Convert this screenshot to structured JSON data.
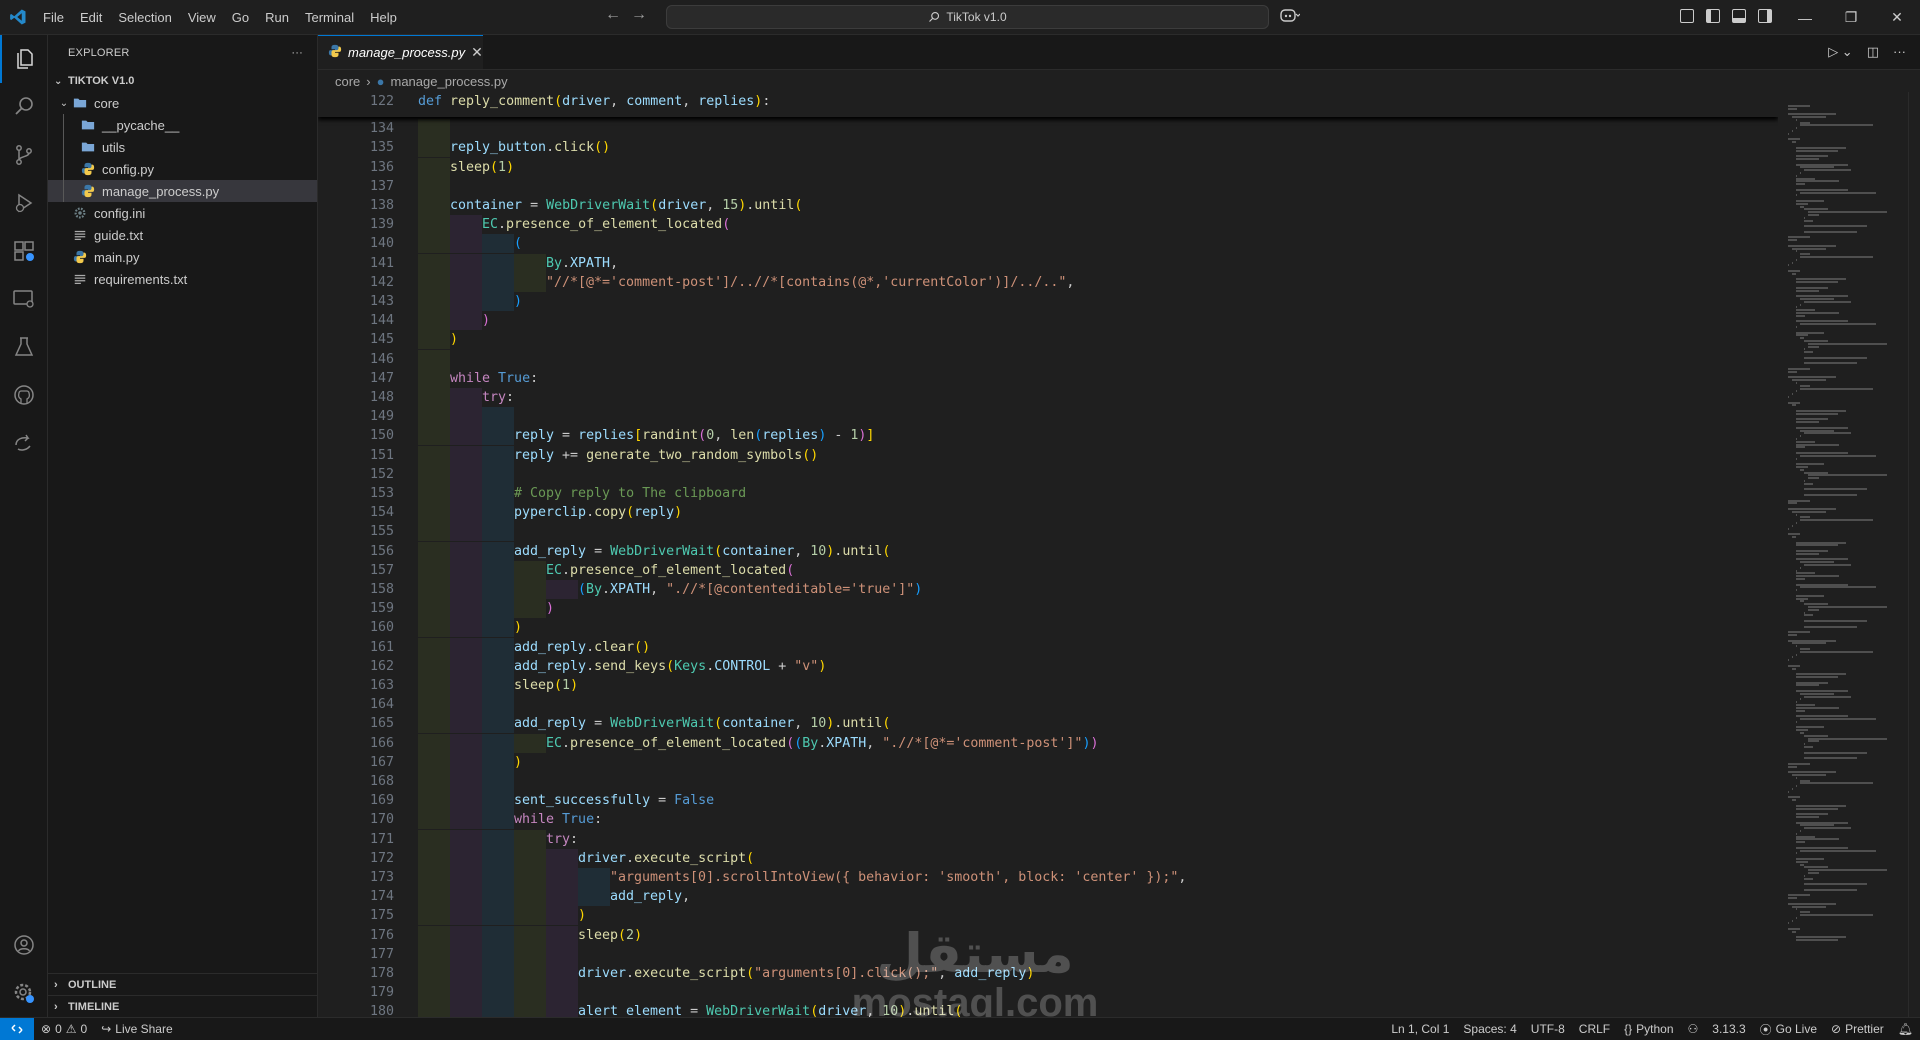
{
  "window": {
    "title": "TikTok v1.0"
  },
  "menu": [
    "File",
    "Edit",
    "Selection",
    "View",
    "Go",
    "Run",
    "Terminal",
    "Help"
  ],
  "activity_bar": [
    "explorer-icon",
    "search-icon",
    "source-control-icon",
    "run-debug-icon",
    "remote-explorer-icon",
    "remote-window-icon",
    "testing-icon",
    "github-icon",
    "live-share-icon",
    "accounts-icon",
    "manage-gear-icon"
  ],
  "explorer": {
    "header": "EXPLORER",
    "root": "TIKTOK V1.0",
    "items": [
      {
        "name": "core",
        "type": "folder",
        "expanded": true,
        "depth": 0
      },
      {
        "name": "__pycache__",
        "type": "folder",
        "depth": 1
      },
      {
        "name": "utils",
        "type": "folder",
        "depth": 1
      },
      {
        "name": "config.py",
        "type": "python",
        "depth": 1
      },
      {
        "name": "manage_process.py",
        "type": "python",
        "depth": 1,
        "selected": true
      },
      {
        "name": "config.ini",
        "type": "settings",
        "depth": 0
      },
      {
        "name": "guide.txt",
        "type": "text",
        "depth": 0
      },
      {
        "name": "main.py",
        "type": "python",
        "depth": 0
      },
      {
        "name": "requirements.txt",
        "type": "text",
        "depth": 0
      }
    ],
    "outline": "OUTLINE",
    "timeline": "TIMELINE"
  },
  "tab": {
    "label": "manage_process.py"
  },
  "breadcrumbs": [
    "core",
    "manage_process.py"
  ],
  "editor": {
    "sticky": {
      "n": 122,
      "t": [
        [
          "kw",
          "def "
        ],
        [
          "fn",
          "reply_comment"
        ],
        [
          "p1",
          "("
        ],
        [
          "var",
          "driver"
        ],
        [
          "def",
          ", "
        ],
        [
          "var",
          "comment"
        ],
        [
          "def",
          ", "
        ],
        [
          "var",
          "replies"
        ],
        [
          "p1",
          ")"
        ],
        [
          "def",
          ":"
        ]
      ]
    },
    "lines": [
      {
        "n": 134,
        "i": 1,
        "t": []
      },
      {
        "n": 135,
        "i": 1,
        "t": [
          [
            "var",
            "reply_button"
          ],
          [
            "def",
            "."
          ],
          [
            "fn",
            "click"
          ],
          [
            "p1",
            "()"
          ]
        ]
      },
      {
        "n": 136,
        "i": 1,
        "t": [
          [
            "fn",
            "sleep"
          ],
          [
            "p1",
            "("
          ],
          [
            "num",
            "1"
          ],
          [
            "p1",
            ")"
          ]
        ]
      },
      {
        "n": 137,
        "i": 1,
        "t": []
      },
      {
        "n": 138,
        "i": 1,
        "t": [
          [
            "var",
            "container"
          ],
          [
            "def",
            " = "
          ],
          [
            "cls",
            "WebDriverWait"
          ],
          [
            "p1",
            "("
          ],
          [
            "var",
            "driver"
          ],
          [
            "def",
            ", "
          ],
          [
            "num",
            "15"
          ],
          [
            "p1",
            ")"
          ],
          [
            "def",
            "."
          ],
          [
            "fn",
            "until"
          ],
          [
            "p1",
            "("
          ]
        ]
      },
      {
        "n": 139,
        "i": 2,
        "t": [
          [
            "cls",
            "EC"
          ],
          [
            "def",
            "."
          ],
          [
            "fn",
            "presence_of_element_located"
          ],
          [
            "p2",
            "("
          ]
        ]
      },
      {
        "n": 140,
        "i": 3,
        "t": [
          [
            "p3",
            "("
          ]
        ]
      },
      {
        "n": 141,
        "i": 4,
        "t": [
          [
            "cls",
            "By"
          ],
          [
            "def",
            "."
          ],
          [
            "var",
            "XPATH"
          ],
          [
            "def",
            ","
          ]
        ]
      },
      {
        "n": 142,
        "i": 4,
        "t": [
          [
            "str",
            "\"//*[@*='comment-post']/..//*[contains(@*,'currentColor')]/../..\""
          ],
          [
            "def",
            ","
          ]
        ]
      },
      {
        "n": 143,
        "i": 3,
        "t": [
          [
            "p3",
            ")"
          ]
        ]
      },
      {
        "n": 144,
        "i": 2,
        "t": [
          [
            "p2",
            ")"
          ]
        ]
      },
      {
        "n": 145,
        "i": 1,
        "t": [
          [
            "p1",
            ")"
          ]
        ]
      },
      {
        "n": 146,
        "i": 1,
        "t": []
      },
      {
        "n": 147,
        "i": 1,
        "t": [
          [
            "ctl",
            "while "
          ],
          [
            "kw",
            "True"
          ],
          [
            "def",
            ":"
          ]
        ]
      },
      {
        "n": 148,
        "i": 2,
        "t": [
          [
            "ctl",
            "try"
          ],
          [
            "def",
            ":"
          ]
        ]
      },
      {
        "n": 149,
        "i": 3,
        "t": []
      },
      {
        "n": 150,
        "i": 3,
        "t": [
          [
            "var",
            "reply"
          ],
          [
            "def",
            " = "
          ],
          [
            "var",
            "replies"
          ],
          [
            "p1",
            "["
          ],
          [
            "fn",
            "randint"
          ],
          [
            "p2",
            "("
          ],
          [
            "num",
            "0"
          ],
          [
            "def",
            ", "
          ],
          [
            "fn",
            "len"
          ],
          [
            "p3",
            "("
          ],
          [
            "var",
            "replies"
          ],
          [
            "p3",
            ")"
          ],
          [
            "def",
            " - "
          ],
          [
            "num",
            "1"
          ],
          [
            "p2",
            ")"
          ],
          [
            "p1",
            "]"
          ]
        ]
      },
      {
        "n": 151,
        "i": 3,
        "t": [
          [
            "var",
            "reply"
          ],
          [
            "def",
            " += "
          ],
          [
            "fn",
            "generate_two_random_symbols"
          ],
          [
            "p1",
            "()"
          ]
        ]
      },
      {
        "n": 152,
        "i": 3,
        "t": []
      },
      {
        "n": 153,
        "i": 3,
        "t": [
          [
            "cmt",
            "# Copy reply to The clipboard"
          ]
        ]
      },
      {
        "n": 154,
        "i": 3,
        "t": [
          [
            "var",
            "pyperclip"
          ],
          [
            "def",
            "."
          ],
          [
            "fn",
            "copy"
          ],
          [
            "p1",
            "("
          ],
          [
            "var",
            "reply"
          ],
          [
            "p1",
            ")"
          ]
        ]
      },
      {
        "n": 155,
        "i": 3,
        "t": []
      },
      {
        "n": 156,
        "i": 3,
        "t": [
          [
            "var",
            "add_reply"
          ],
          [
            "def",
            " = "
          ],
          [
            "cls",
            "WebDriverWait"
          ],
          [
            "p1",
            "("
          ],
          [
            "var",
            "container"
          ],
          [
            "def",
            ", "
          ],
          [
            "num",
            "10"
          ],
          [
            "p1",
            ")"
          ],
          [
            "def",
            "."
          ],
          [
            "fn",
            "until"
          ],
          [
            "p1",
            "("
          ]
        ]
      },
      {
        "n": 157,
        "i": 4,
        "t": [
          [
            "cls",
            "EC"
          ],
          [
            "def",
            "."
          ],
          [
            "fn",
            "presence_of_element_located"
          ],
          [
            "p2",
            "("
          ]
        ]
      },
      {
        "n": 158,
        "i": 5,
        "t": [
          [
            "p3",
            "("
          ],
          [
            "cls",
            "By"
          ],
          [
            "def",
            "."
          ],
          [
            "var",
            "XPATH"
          ],
          [
            "def",
            ", "
          ],
          [
            "str",
            "\".//*[@contenteditable='true']\""
          ],
          [
            "p3",
            ")"
          ]
        ]
      },
      {
        "n": 159,
        "i": 4,
        "t": [
          [
            "p2",
            ")"
          ]
        ]
      },
      {
        "n": 160,
        "i": 3,
        "t": [
          [
            "p1",
            ")"
          ]
        ]
      },
      {
        "n": 161,
        "i": 3,
        "t": [
          [
            "var",
            "add_reply"
          ],
          [
            "def",
            "."
          ],
          [
            "fn",
            "clear"
          ],
          [
            "p1",
            "()"
          ]
        ]
      },
      {
        "n": 162,
        "i": 3,
        "t": [
          [
            "var",
            "add_reply"
          ],
          [
            "def",
            "."
          ],
          [
            "fn",
            "send_keys"
          ],
          [
            "p1",
            "("
          ],
          [
            "cls",
            "Keys"
          ],
          [
            "def",
            "."
          ],
          [
            "var",
            "CONTROL"
          ],
          [
            "def",
            " + "
          ],
          [
            "str",
            "\"v\""
          ],
          [
            "p1",
            ")"
          ]
        ]
      },
      {
        "n": 163,
        "i": 3,
        "t": [
          [
            "fn",
            "sleep"
          ],
          [
            "p1",
            "("
          ],
          [
            "num",
            "1"
          ],
          [
            "p1",
            ")"
          ]
        ]
      },
      {
        "n": 164,
        "i": 3,
        "t": []
      },
      {
        "n": 165,
        "i": 3,
        "t": [
          [
            "var",
            "add_reply"
          ],
          [
            "def",
            " = "
          ],
          [
            "cls",
            "WebDriverWait"
          ],
          [
            "p1",
            "("
          ],
          [
            "var",
            "container"
          ],
          [
            "def",
            ", "
          ],
          [
            "num",
            "10"
          ],
          [
            "p1",
            ")"
          ],
          [
            "def",
            "."
          ],
          [
            "fn",
            "until"
          ],
          [
            "p1",
            "("
          ]
        ]
      },
      {
        "n": 166,
        "i": 4,
        "t": [
          [
            "cls",
            "EC"
          ],
          [
            "def",
            "."
          ],
          [
            "fn",
            "presence_of_element_located"
          ],
          [
            "p2",
            "("
          ],
          [
            "p3",
            "("
          ],
          [
            "cls",
            "By"
          ],
          [
            "def",
            "."
          ],
          [
            "var",
            "XPATH"
          ],
          [
            "def",
            ", "
          ],
          [
            "str",
            "\".//*[@*='comment-post']\""
          ],
          [
            "p3",
            ")"
          ],
          [
            "p2",
            ")"
          ]
        ]
      },
      {
        "n": 167,
        "i": 3,
        "t": [
          [
            "p1",
            ")"
          ]
        ]
      },
      {
        "n": 168,
        "i": 3,
        "t": []
      },
      {
        "n": 169,
        "i": 3,
        "t": [
          [
            "var",
            "sent_successfully"
          ],
          [
            "def",
            " = "
          ],
          [
            "kw",
            "False"
          ]
        ]
      },
      {
        "n": 170,
        "i": 3,
        "t": [
          [
            "ctl",
            "while "
          ],
          [
            "kw",
            "True"
          ],
          [
            "def",
            ":"
          ]
        ]
      },
      {
        "n": 171,
        "i": 4,
        "t": [
          [
            "ctl",
            "try"
          ],
          [
            "def",
            ":"
          ]
        ]
      },
      {
        "n": 172,
        "i": 5,
        "t": [
          [
            "var",
            "driver"
          ],
          [
            "def",
            "."
          ],
          [
            "fn",
            "execute_script"
          ],
          [
            "p1",
            "("
          ]
        ]
      },
      {
        "n": 173,
        "i": 6,
        "t": [
          [
            "str",
            "\"arguments[0].scrollIntoView({ behavior: 'smooth', block: 'center' });\""
          ],
          [
            "def",
            ","
          ]
        ]
      },
      {
        "n": 174,
        "i": 6,
        "t": [
          [
            "var",
            "add_reply"
          ],
          [
            "def",
            ","
          ]
        ]
      },
      {
        "n": 175,
        "i": 5,
        "t": [
          [
            "p1",
            ")"
          ]
        ]
      },
      {
        "n": 176,
        "i": 5,
        "t": [
          [
            "fn",
            "sleep"
          ],
          [
            "p1",
            "("
          ],
          [
            "num",
            "2"
          ],
          [
            "p1",
            ")"
          ]
        ]
      },
      {
        "n": 177,
        "i": 5,
        "t": []
      },
      {
        "n": 178,
        "i": 5,
        "t": [
          [
            "var",
            "driver"
          ],
          [
            "def",
            "."
          ],
          [
            "fn",
            "execute_script"
          ],
          [
            "p1",
            "("
          ],
          [
            "str",
            "\"arguments[0].click();\""
          ],
          [
            "def",
            ", "
          ],
          [
            "var",
            "add_reply"
          ],
          [
            "p1",
            ")"
          ]
        ]
      },
      {
        "n": 179,
        "i": 5,
        "t": []
      },
      {
        "n": 180,
        "i": 5,
        "t": [
          [
            "var",
            "alert_element"
          ],
          [
            "def",
            " = "
          ],
          [
            "cls",
            "WebDriverWait"
          ],
          [
            "p1",
            "("
          ],
          [
            "var",
            "driver"
          ],
          [
            "def",
            ", "
          ],
          [
            "num",
            "10"
          ],
          [
            "p1",
            ")"
          ],
          [
            "def",
            "."
          ],
          [
            "fn",
            "until"
          ],
          [
            "p1",
            "("
          ]
        ]
      }
    ]
  },
  "watermark": {
    "arabic": "مستقل",
    "latin": "mostaql.com"
  },
  "status": {
    "errors": "0",
    "warnings": "0",
    "live_share": "Live Share",
    "cursor": "Ln 1, Col 1",
    "spaces": "Spaces: 4",
    "encoding": "UTF-8",
    "eol": "CRLF",
    "language": "Python",
    "python_version": "3.13.3",
    "go_live": "Go Live",
    "prettier": "Prettier"
  },
  "colors": {
    "accent": "#0078d4",
    "background": "#1f1f1f",
    "sidebar": "#181818",
    "selection": "#37373d"
  }
}
